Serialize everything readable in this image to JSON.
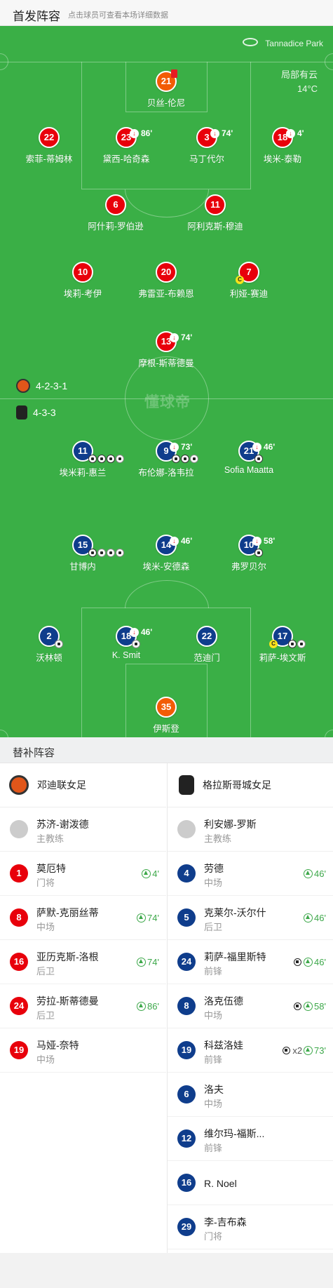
{
  "header": {
    "title": "首发阵容",
    "hint": "点击球员可查看本场详细数据"
  },
  "venue": "Tannadice Park",
  "weather": {
    "cond": "局部有云",
    "temp": "14°C"
  },
  "watermark": "懂球帝",
  "home_formation": "4-2-3-1",
  "away_formation": "4-3-3",
  "colors": {
    "home": "#e8000b",
    "away": "#0f3d8c",
    "gk": "#f25c05",
    "pitch": "#3aaf46"
  },
  "home": [
    {
      "n": "21",
      "name": "贝丝-伦尼",
      "gk": true,
      "card": "red"
    },
    {
      "n": "22",
      "name": "索菲-蒂姆林"
    },
    {
      "n": "23",
      "name": "黛西-哈奇森",
      "sub": "86'"
    },
    {
      "n": "3",
      "name": "马丁代尔",
      "sub": "74'"
    },
    {
      "n": "18",
      "name": "埃米-泰勒",
      "sub": "4'"
    },
    {
      "n": "6",
      "name": "阿什莉-罗伯逊"
    },
    {
      "n": "11",
      "name": "阿利克斯-穆迪"
    },
    {
      "n": "10",
      "name": "埃莉-考伊"
    },
    {
      "n": "20",
      "name": "弗雷亚-布赖恩"
    },
    {
      "n": "7",
      "name": "利娅-赛迪",
      "captain": "C"
    },
    {
      "n": "13",
      "name": "摩根-斯蒂德曼",
      "sub": "74'"
    }
  ],
  "away": [
    {
      "n": "11",
      "name": "埃米莉-惠兰",
      "goals": 3,
      "assist": 1
    },
    {
      "n": "9",
      "name": "布伦娜-洛韦拉",
      "sub": "73'",
      "goals": 2,
      "assist": 1
    },
    {
      "n": "21",
      "name": "Sofia Maatta",
      "sub": "46'",
      "goals": 1
    },
    {
      "n": "15",
      "name": "甘博内",
      "goals": 1,
      "assist": 3
    },
    {
      "n": "14",
      "name": "埃米-安德森",
      "sub": "46'"
    },
    {
      "n": "10",
      "name": "弗罗贝尔",
      "sub": "58'",
      "goals": 1
    },
    {
      "n": "2",
      "name": "沃林顿",
      "assist": 1
    },
    {
      "n": "18",
      "name": "K. Smit",
      "sub": "46'",
      "assist": 1
    },
    {
      "n": "22",
      "name": "范迪门"
    },
    {
      "n": "17",
      "name": "莉萨-埃文斯",
      "captain": "C",
      "goals": 1,
      "assist": 1
    },
    {
      "n": "35",
      "name": "伊斯登",
      "gk": true
    }
  ],
  "subs": {
    "title": "替补阵容",
    "home_team": "邓迪联女足",
    "away_team": "格拉斯哥城女足",
    "home_coach": {
      "name": "苏济-谢泼德",
      "role": "主教练"
    },
    "away_coach": {
      "name": "利安娜-罗斯",
      "role": "主教练"
    },
    "home_list": [
      {
        "n": "1",
        "name": "莫厄特",
        "pos": "门将",
        "min": "4'",
        "gk": true
      },
      {
        "n": "8",
        "name": "萨默-克丽丝蒂",
        "pos": "中场",
        "min": "74'"
      },
      {
        "n": "16",
        "name": "亚历克斯-洛根",
        "pos": "后卫",
        "min": "74'"
      },
      {
        "n": "24",
        "name": "劳拉-斯蒂德曼",
        "pos": "后卫",
        "min": "86'"
      },
      {
        "n": "19",
        "name": "马娅-奈特",
        "pos": "中场",
        "min": ""
      }
    ],
    "away_list": [
      {
        "n": "4",
        "name": "劳德",
        "pos": "中场",
        "min": "46'"
      },
      {
        "n": "5",
        "name": "克莱尔-沃尔什",
        "pos": "后卫",
        "min": "46'"
      },
      {
        "n": "24",
        "name": "莉萨-福里斯特",
        "pos": "前锋",
        "min": "46'",
        "goal": ""
      },
      {
        "n": "8",
        "name": "洛克伍德",
        "pos": "中场",
        "min": "58'",
        "goal": ""
      },
      {
        "n": "19",
        "name": "科兹洛娃",
        "pos": "前锋",
        "min": "73'",
        "goal": "x2"
      },
      {
        "n": "6",
        "name": "洛夫",
        "pos": "中场",
        "min": ""
      },
      {
        "n": "12",
        "name": "维尔玛-福斯...",
        "pos": "前锋",
        "min": ""
      },
      {
        "n": "16",
        "name": "R. Noel",
        "pos": "",
        "min": ""
      },
      {
        "n": "29",
        "name": "李-吉布森",
        "pos": "门将",
        "min": ""
      }
    ]
  }
}
